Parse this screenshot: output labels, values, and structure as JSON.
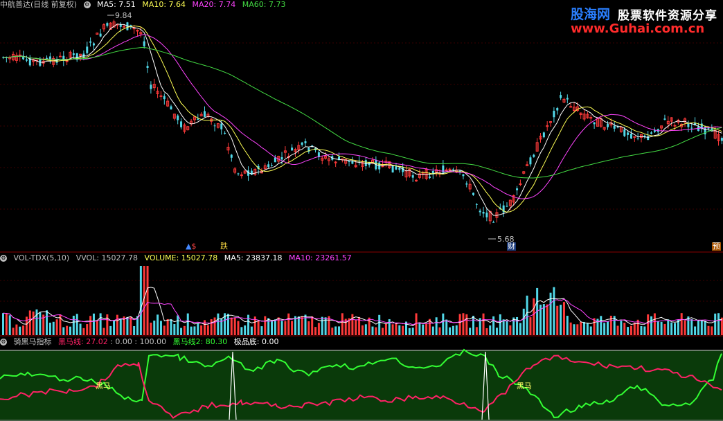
{
  "price_header": {
    "title": "中航善达(日线 前复权)",
    "ma5": "MA5: 7.51",
    "ma10": "MA10: 7.64",
    "ma20": "MA20: 7.74",
    "ma60": "MA60: 7.73"
  },
  "price_labels": {
    "high": "9.84",
    "low": "5.68"
  },
  "markers": {
    "m1": "$",
    "m2": "跌",
    "m3": "财",
    "m4": "预"
  },
  "logo": {
    "site_a": "股海网",
    "site_b": "股票软件资源分享",
    "url": "www.Guhai.com.cn"
  },
  "volume_header": {
    "name": "VOL-TDX(5,10)",
    "vvol": "VVOL: 15027.78",
    "volume": "VOLUME: 15027.78",
    "ma5": "MA5: 23837.18",
    "ma10": "MA10: 23261.57"
  },
  "indicator_header": {
    "name": "骑黑马指标",
    "line1": "黑马线: 27.02",
    "ticks": ": 0.00 : 100.00",
    "line2": "黑马线2: 80.30",
    "bottom": "极品底: 0.00"
  },
  "indicator_labels": {
    "signal_a": "黑马",
    "signal_b": "黑马"
  },
  "colors": {
    "up": "#ff3a3a",
    "down": "#52d8e8",
    "ma5": "#ffffff",
    "ma10": "#ffff55",
    "ma20": "#ff44ff",
    "ma60": "#44dd44",
    "line1": "#ff2266",
    "line2": "#33ff33",
    "bg_ind": "#0a3a0a"
  },
  "icons": {
    "settings": "gear-icon"
  }
}
